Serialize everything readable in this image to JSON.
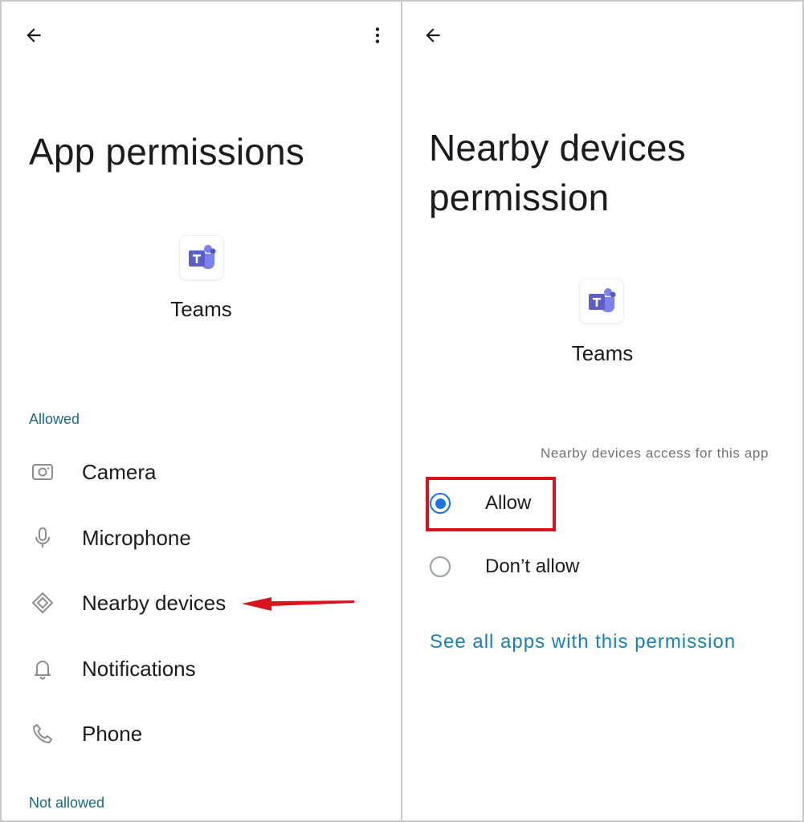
{
  "left": {
    "title": "App permissions",
    "app_name": "Teams",
    "allowed_header": "Allowed",
    "items": [
      {
        "label": "Camera",
        "icon": "camera-icon"
      },
      {
        "label": "Microphone",
        "icon": "microphone-icon"
      },
      {
        "label": "Nearby devices",
        "icon": "nearby-devices-icon"
      },
      {
        "label": "Notifications",
        "icon": "bell-icon"
      },
      {
        "label": "Phone",
        "icon": "phone-icon"
      }
    ],
    "not_allowed_header": "Not allowed"
  },
  "right": {
    "title_line1": "Nearby devices",
    "title_line2": "permission",
    "app_name": "Teams",
    "access_caption": "Nearby devices access for this app",
    "options": [
      {
        "label": "Allow",
        "selected": true
      },
      {
        "label": "Don’t allow",
        "selected": false
      }
    ],
    "see_all_link": "See all apps with this permission"
  },
  "colors": {
    "accent_blue": "#1a73e8",
    "section_teal": "#1a6a80",
    "link_blue": "#1a7fb5",
    "annotation_red": "#d8141c",
    "teams_purple": "#5b5fc7"
  }
}
